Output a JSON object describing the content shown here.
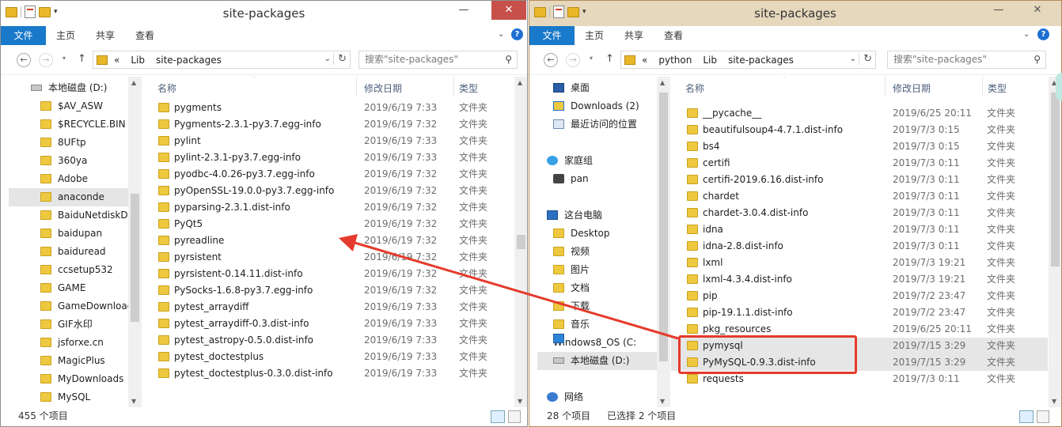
{
  "left": {
    "title": "site-packages",
    "tabs": {
      "file": "文件",
      "home": "主页",
      "share": "共享",
      "view": "查看"
    },
    "help": "?",
    "address": [
      "«",
      "Lib",
      "site-packages"
    ],
    "search_placeholder": "搜索\"site-packages\"",
    "columns": {
      "name": "名称",
      "date": "修改日期",
      "type": "类型"
    },
    "tree": [
      {
        "label": "本地磁盘 (D:)",
        "icon": "drive-icon"
      },
      {
        "label": "$AV_ASW",
        "icon": "folder-icon"
      },
      {
        "label": "$RECYCLE.BIN",
        "icon": "folder-icon"
      },
      {
        "label": "8UFtp",
        "icon": "folder-icon"
      },
      {
        "label": "360ya",
        "icon": "folder-icon"
      },
      {
        "label": "Adobe",
        "icon": "folder-icon"
      },
      {
        "label": "anaconde",
        "icon": "folder-icon"
      },
      {
        "label": "BaiduNetdiskDo",
        "icon": "folder-icon"
      },
      {
        "label": "baidupan",
        "icon": "folder-icon"
      },
      {
        "label": "baiduread",
        "icon": "folder-icon"
      },
      {
        "label": "ccsetup532",
        "icon": "folder-icon"
      },
      {
        "label": "GAME",
        "icon": "folder-icon"
      },
      {
        "label": "GameDownload",
        "icon": "folder-icon"
      },
      {
        "label": "GIF水印",
        "icon": "folder-icon"
      },
      {
        "label": "jsforxe.cn",
        "icon": "folder-icon"
      },
      {
        "label": "MagicPlus",
        "icon": "folder-icon"
      },
      {
        "label": "MyDownloads",
        "icon": "folder-icon"
      },
      {
        "label": "MySQL",
        "icon": "folder-icon"
      }
    ],
    "files": [
      {
        "name": "pygments",
        "date": "2019/6/19 7:33",
        "type": "文件夹"
      },
      {
        "name": "Pygments-2.3.1-py3.7.egg-info",
        "date": "2019/6/19 7:32",
        "type": "文件夹"
      },
      {
        "name": "pylint",
        "date": "2019/6/19 7:33",
        "type": "文件夹"
      },
      {
        "name": "pylint-2.3.1-py3.7.egg-info",
        "date": "2019/6/19 7:33",
        "type": "文件夹"
      },
      {
        "name": "pyodbc-4.0.26-py3.7.egg-info",
        "date": "2019/6/19 7:32",
        "type": "文件夹"
      },
      {
        "name": "pyOpenSSL-19.0.0-py3.7.egg-info",
        "date": "2019/6/19 7:32",
        "type": "文件夹"
      },
      {
        "name": "pyparsing-2.3.1.dist-info",
        "date": "2019/6/19 7:32",
        "type": "文件夹"
      },
      {
        "name": "PyQt5",
        "date": "2019/6/19 7:32",
        "type": "文件夹"
      },
      {
        "name": "pyreadline",
        "date": "2019/6/19 7:32",
        "type": "文件夹"
      },
      {
        "name": "pyrsistent",
        "date": "2019/6/19 7:32",
        "type": "文件夹"
      },
      {
        "name": "pyrsistent-0.14.11.dist-info",
        "date": "2019/6/19 7:32",
        "type": "文件夹"
      },
      {
        "name": "PySocks-1.6.8-py3.7.egg-info",
        "date": "2019/6/19 7:32",
        "type": "文件夹"
      },
      {
        "name": "pytest_arraydiff",
        "date": "2019/6/19 7:33",
        "type": "文件夹"
      },
      {
        "name": "pytest_arraydiff-0.3.dist-info",
        "date": "2019/6/19 7:33",
        "type": "文件夹"
      },
      {
        "name": "pytest_astropy-0.5.0.dist-info",
        "date": "2019/6/19 7:33",
        "type": "文件夹"
      },
      {
        "name": "pytest_doctestplus",
        "date": "2019/6/19 7:33",
        "type": "文件夹"
      },
      {
        "name": "pytest_doctestplus-0.3.0.dist-info",
        "date": "2019/6/19 7:33",
        "type": "文件夹"
      }
    ],
    "status": "455 个项目"
  },
  "right": {
    "title": "site-packages",
    "tabs": {
      "file": "文件",
      "home": "主页",
      "share": "共享",
      "view": "查看"
    },
    "help": "?",
    "address": [
      "«",
      "python",
      "Lib",
      "site-packages"
    ],
    "search_placeholder": "搜索\"site-packages\"",
    "columns": {
      "name": "名称",
      "date": "修改日期",
      "type": "类型"
    },
    "tree": [
      {
        "label": "桌面",
        "icon": "desktop-icon"
      },
      {
        "label": "Downloads (2)",
        "icon": "downloads-folder-icon"
      },
      {
        "label": "最近访问的位置",
        "icon": "recent-places-icon"
      },
      {
        "label": "",
        "icon": ""
      },
      {
        "label": "家庭组",
        "icon": "homegroup-icon"
      },
      {
        "label": "pan",
        "icon": "user-icon"
      },
      {
        "label": "",
        "icon": ""
      },
      {
        "label": "这台电脑",
        "icon": "this-pc-icon"
      },
      {
        "label": "Desktop",
        "icon": "folder-icon"
      },
      {
        "label": "视频",
        "icon": "folder-icon"
      },
      {
        "label": "图片",
        "icon": "folder-icon"
      },
      {
        "label": "文档",
        "icon": "folder-icon"
      },
      {
        "label": "下载",
        "icon": "folder-icon"
      },
      {
        "label": "音乐",
        "icon": "folder-icon"
      },
      {
        "label": "Windows8_OS (C:",
        "icon": "windows-drive-icon"
      },
      {
        "label": "本地磁盘 (D:)",
        "icon": "drive-icon"
      },
      {
        "label": "",
        "icon": ""
      },
      {
        "label": "网络",
        "icon": "network-icon"
      }
    ],
    "files": [
      {
        "name": "__pycache__",
        "date": "2019/6/25 20:11",
        "type": "文件夹"
      },
      {
        "name": "beautifulsoup4-4.7.1.dist-info",
        "date": "2019/7/3 0:15",
        "type": "文件夹"
      },
      {
        "name": "bs4",
        "date": "2019/7/3 0:15",
        "type": "文件夹"
      },
      {
        "name": "certifi",
        "date": "2019/7/3 0:11",
        "type": "文件夹"
      },
      {
        "name": "certifi-2019.6.16.dist-info",
        "date": "2019/7/3 0:11",
        "type": "文件夹"
      },
      {
        "name": "chardet",
        "date": "2019/7/3 0:11",
        "type": "文件夹"
      },
      {
        "name": "chardet-3.0.4.dist-info",
        "date": "2019/7/3 0:11",
        "type": "文件夹"
      },
      {
        "name": "idna",
        "date": "2019/7/3 0:11",
        "type": "文件夹"
      },
      {
        "name": "idna-2.8.dist-info",
        "date": "2019/7/3 0:11",
        "type": "文件夹"
      },
      {
        "name": "lxml",
        "date": "2019/7/3 19:21",
        "type": "文件夹"
      },
      {
        "name": "lxml-4.3.4.dist-info",
        "date": "2019/7/3 19:21",
        "type": "文件夹"
      },
      {
        "name": "pip",
        "date": "2019/7/2 23:47",
        "type": "文件夹"
      },
      {
        "name": "pip-19.1.1.dist-info",
        "date": "2019/7/2 23:47",
        "type": "文件夹"
      },
      {
        "name": "pkg_resources",
        "date": "2019/6/25 20:11",
        "type": "文件夹"
      },
      {
        "name": "pymysql",
        "date": "2019/7/15 3:29",
        "type": "文件夹",
        "selected": true
      },
      {
        "name": "PyMySQL-0.9.3.dist-info",
        "date": "2019/7/15 3:29",
        "type": "文件夹",
        "selected": true
      },
      {
        "name": "requests",
        "date": "2019/7/3 0:11",
        "type": "文件夹"
      }
    ],
    "status": "28 个项目",
    "selection": "已选择 2 个项目"
  },
  "colors": {
    "accent": "#1979ca",
    "annotation": "#e53b2c",
    "right_frame": "#e6d8bd"
  }
}
